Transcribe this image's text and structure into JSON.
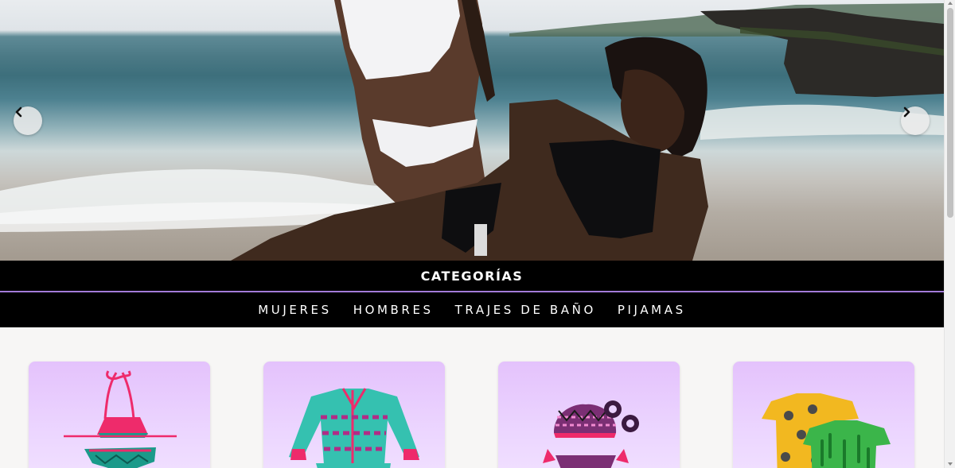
{
  "hero": {
    "image_icon": "beach-swimwear-photo",
    "prev_icon": "chevron-left-icon",
    "next_icon": "chevron-right-icon"
  },
  "categories": {
    "title": "CATEGORÍAS",
    "items": [
      {
        "label": "MUJERES"
      },
      {
        "label": "HOMBRES"
      },
      {
        "label": "TRAJES DE BAÑO"
      },
      {
        "label": "PIJAMAS"
      }
    ],
    "accent_color": "#a27bd8"
  },
  "products": [
    {
      "image_icon": "bikini-pink-teal-image"
    },
    {
      "image_icon": "long-sleeve-swimsuit-image"
    },
    {
      "image_icon": "tribal-bikini-scrunchies-image"
    },
    {
      "image_icon": "printed-kids-shirts-image"
    }
  ]
}
